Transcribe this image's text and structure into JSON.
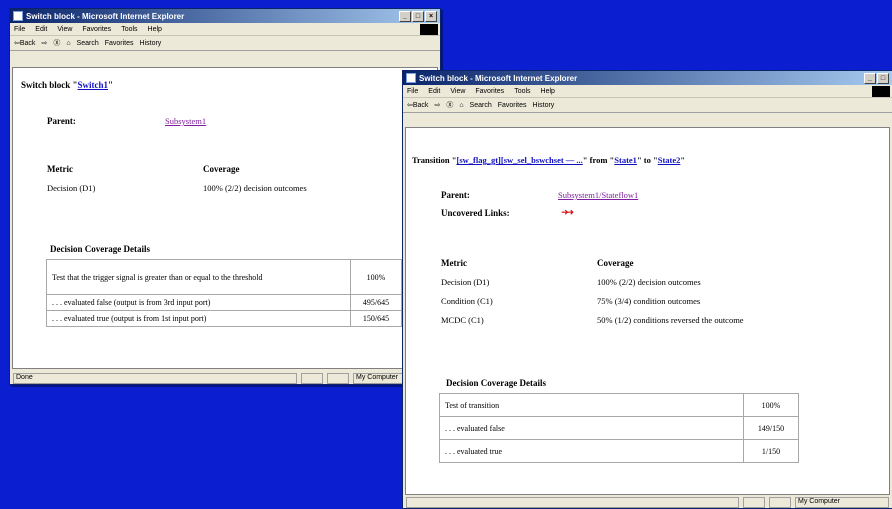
{
  "window1": {
    "title": "Switch block - Microsoft Internet Explorer",
    "menu": [
      "File",
      "Edit",
      "View",
      "Favorites",
      "Tools",
      "Help"
    ],
    "toolbar": [
      "⇦Back",
      "⇨",
      "Ⓧ",
      "⌂",
      "Search",
      "Favorites",
      "History"
    ],
    "heading_prefix": "Switch block \"",
    "heading_link": "Switch1",
    "heading_suffix": "\"",
    "parent_label": "Parent:",
    "parent_value": "Subsystem1",
    "metric_header": "Metric",
    "coverage_header": "Coverage",
    "metric_row": "Decision (D1)",
    "coverage_row": "100% (2/2) decision outcomes",
    "details_title": "Decision Coverage Details",
    "details": [
      {
        "text": "Test that the trigger signal is greater than or equal to the threshold",
        "value": "100%"
      },
      {
        "text": ". . . evaluated false (output is from 3rd input port)",
        "value": "495/645"
      },
      {
        "text": ". . . evaluated true (output is from 1st input port)",
        "value": "150/645"
      }
    ],
    "status_left": "Done",
    "status_right": "My Computer"
  },
  "window2": {
    "title": "Switch block - Microsoft Internet Explorer",
    "menu": [
      "File",
      "Edit",
      "View",
      "Favorites",
      "Tools",
      "Help"
    ],
    "toolbar": [
      "⇦Back",
      "⇨",
      "Ⓧ",
      "⌂",
      "Search",
      "Favorites",
      "History"
    ],
    "heading_prefix": "Transition \"",
    "heading_link": "[sw_flag_gt][sw_sel_bswchset — ...",
    "heading_mid": "\" from \"",
    "from_link": "State1",
    "heading_to": "\" to \"",
    "to_link": "State2",
    "heading_suffix": "\"",
    "parent_label": "Parent:",
    "parent_value": "Subsystem1/Stateflow1",
    "uncovered_label": "Uncovered Links:",
    "uncovered_value": "➜➜",
    "metric_header": "Metric",
    "coverage_header": "Coverage",
    "metrics": [
      {
        "metric": "Decision (D1)",
        "coverage": "100% (2/2) decision outcomes"
      },
      {
        "metric": "Condition (C1)",
        "coverage": "75% (3/4) condition outcomes"
      },
      {
        "metric": "MCDC (C1)",
        "coverage": "50% (1/2) conditions reversed the outcome"
      }
    ],
    "details_title": "Decision Coverage Details",
    "details": [
      {
        "text": "Test of transition",
        "value": "100%"
      },
      {
        "text": ". . . evaluated false",
        "value": "149/150"
      },
      {
        "text": ". . . evaluated true",
        "value": "1/150"
      }
    ],
    "status_right": "My Computer"
  }
}
